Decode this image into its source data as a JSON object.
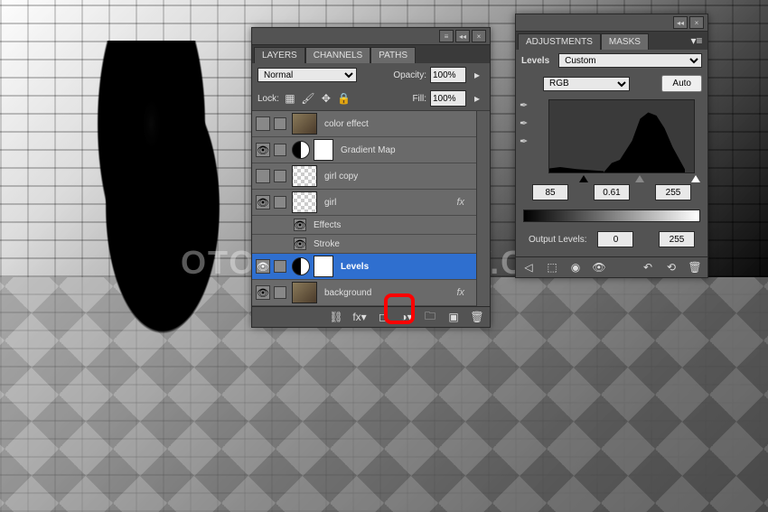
{
  "watermark": "OTOSHOPSUPPLY.CO",
  "layersPanel": {
    "tabs": [
      "LAYERS",
      "CHANNELS",
      "PATHS"
    ],
    "blend": {
      "label": "Normal",
      "options": [
        "Normal"
      ]
    },
    "opacity": {
      "label": "Opacity:",
      "value": "100%"
    },
    "lock": {
      "label": "Lock:"
    },
    "fill": {
      "label": "Fill:",
      "value": "100%"
    },
    "layers": [
      {
        "name": "color effect",
        "vis": false,
        "thumb": "img"
      },
      {
        "name": "Gradient Map",
        "vis": true,
        "adj": true,
        "thumb": "grad",
        "mask": true
      },
      {
        "name": "girl copy",
        "vis": false,
        "thumb": "checker"
      },
      {
        "name": "girl",
        "vis": true,
        "thumb": "checker",
        "fx": "fx"
      },
      {
        "name": "Levels",
        "vis": true,
        "adj": true,
        "thumb": "white",
        "mask": true,
        "sel": true
      },
      {
        "name": "background",
        "vis": true,
        "thumb": "img",
        "fx": "fx"
      }
    ],
    "effects": {
      "label": "Effects",
      "item": "Stroke"
    }
  },
  "adjPanel": {
    "tabs": [
      "ADJUSTMENTS",
      "MASKS"
    ],
    "title": "Levels",
    "preset": "Custom",
    "channel": "RGB",
    "auto": "Auto",
    "inputs": {
      "black": "85",
      "mid": "0.61",
      "white": "255"
    },
    "outputLabel": "Output Levels:",
    "outputs": {
      "black": "0",
      "white": "255"
    }
  }
}
